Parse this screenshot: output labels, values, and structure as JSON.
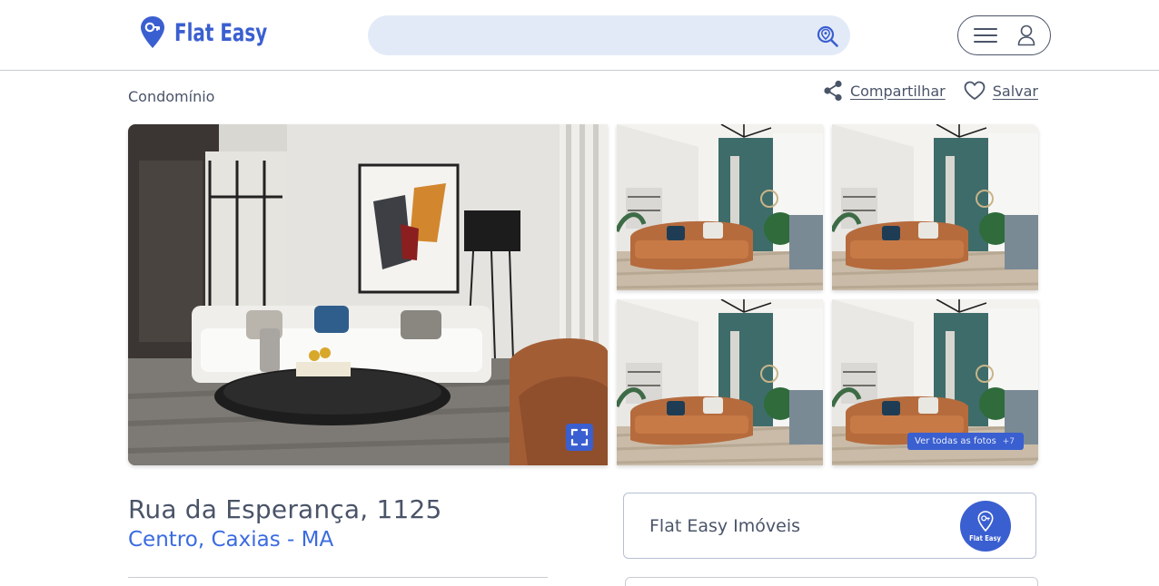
{
  "brand": {
    "name": "Flat Easy",
    "accent_color": "#3a5fd0",
    "text_color": "#4a5468",
    "link_color": "#3a6be0"
  },
  "header": {
    "search": {
      "value": "",
      "placeholder": ""
    },
    "search_icon": "location-search-icon",
    "menu_icon": "hamburger-icon",
    "user_icon": "user-icon"
  },
  "listing": {
    "category": "Condomínio",
    "actions": {
      "share_label": "Compartilhar",
      "share_icon": "share-icon",
      "save_label": "Salvar",
      "save_icon": "heart-icon"
    },
    "gallery": {
      "expand_icon": "fullscreen-icon",
      "see_all_label": "Ver todas as fotos",
      "see_all_count": "+7"
    },
    "address": {
      "street": "Rua da Esperança, 1125",
      "city": "Centro, Caxias - MA"
    }
  },
  "agency": {
    "name": "Flat Easy Imóveis",
    "logo_text": "Flat Easy"
  }
}
